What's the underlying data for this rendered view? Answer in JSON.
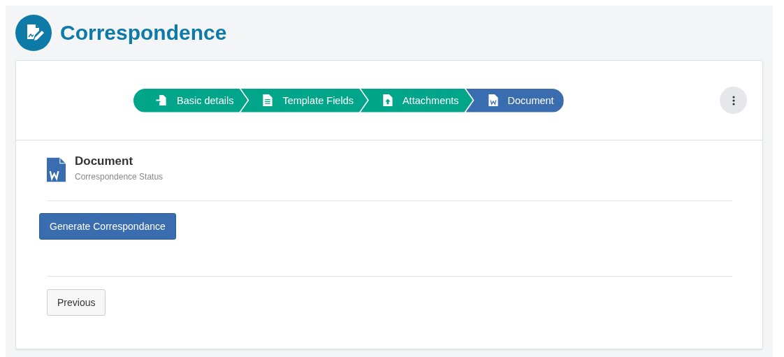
{
  "page": {
    "title": "Correspondence"
  },
  "steps": [
    {
      "label": "Basic details",
      "kind": "enter",
      "selected": false
    },
    {
      "label": "Template Fields",
      "kind": "list",
      "selected": false
    },
    {
      "label": "Attachments",
      "kind": "upload",
      "selected": false
    },
    {
      "label": "Document",
      "kind": "word",
      "selected": true
    }
  ],
  "document": {
    "title": "Document",
    "subtitle": "Correspondence Status"
  },
  "buttons": {
    "generate": "Generate Correspondance",
    "previous": "Previous"
  }
}
